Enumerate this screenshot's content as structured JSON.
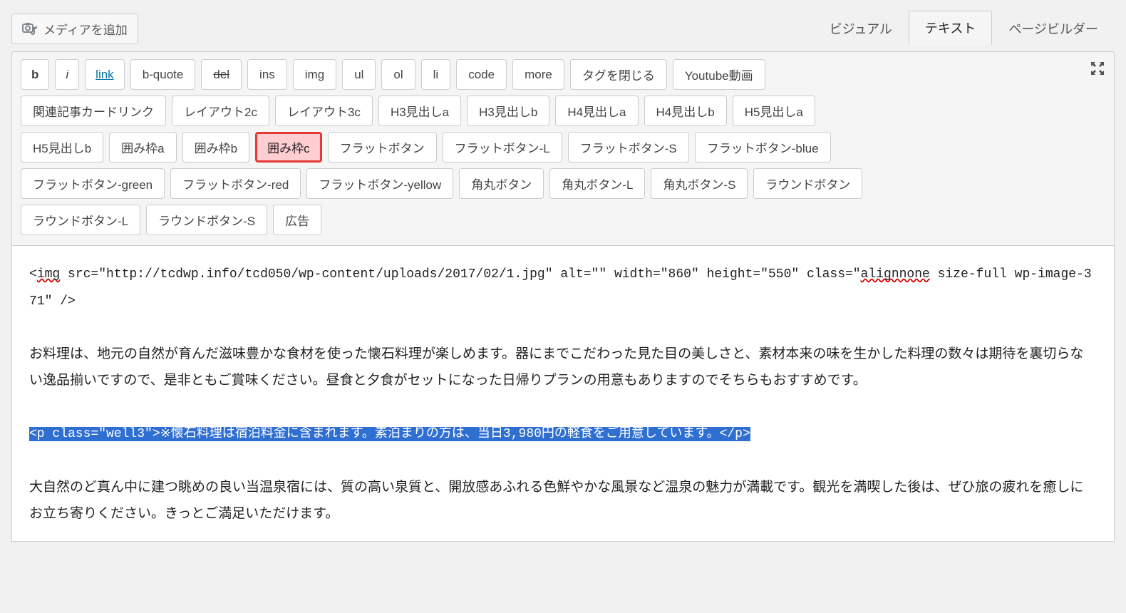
{
  "media_button_label": "メディアを追加",
  "tabs": {
    "visual": "ビジュアル",
    "text": "テキスト",
    "pagebuilder": "ページビルダー"
  },
  "quicktags": {
    "row1": [
      "b",
      "i",
      "link",
      "b-quote",
      "del",
      "ins",
      "img",
      "ul",
      "ol",
      "li",
      "code",
      "more",
      "タグを閉じる",
      "Youtube動画"
    ],
    "row2": [
      "関連記事カードリンク",
      "レイアウト2c",
      "レイアウト3c",
      "H3見出しa",
      "H3見出しb",
      "H4見出しa",
      "H4見出しb",
      "H5見出しa"
    ],
    "row3": [
      "H5見出しb",
      "囲み枠a",
      "囲み枠b",
      "囲み枠c",
      "フラットボタン",
      "フラットボタン-L",
      "フラットボタン-S",
      "フラットボタン-blue"
    ],
    "row4": [
      "フラットボタン-green",
      "フラットボタン-red",
      "フラットボタン-yellow",
      "角丸ボタン",
      "角丸ボタン-L",
      "角丸ボタン-S",
      "ラウンドボタン"
    ],
    "row5": [
      "ラウンドボタン-L",
      "ラウンドボタン-S",
      "広告"
    ]
  },
  "highlighted_quicktag": "囲み枠c",
  "editor_content": {
    "code_line1_a": "<",
    "code_line1_img": "img",
    "code_line1_b": " src=\"http://tcdwp.info/tcd050/wp-content/uploads/2017/02/1.jpg\" alt=\"\" width=\"860\" height=\"550\" class=\"",
    "code_line1_align": "alignnone",
    "code_line1_c": " size-full wp-image-371\" />",
    "para1": "お料理は、地元の自然が育んだ滋味豊かな食材を使った懐石料理が楽しめます。器にまでこだわった見た目の美しさと、素材本来の味を生かした料理の数々は期待を裏切らない逸品揃いですので、是非ともご賞味ください。昼食と夕食がセットになった日帰りプランの用意もありますのでそちらもおすすめです。",
    "selected_line": "<p class=\"well3\">※懐石料理は宿泊料金に含まれます。素泊まりの方は、当日3,980円の軽食をご用意しています。</p>",
    "para2": "大自然のど真ん中に建つ眺めの良い当温泉宿には、質の高い泉質と、開放感あふれる色鮮やかな風景など温泉の魅力が満載です。観光を満喫した後は、ぜひ旅の疲れを癒しにお立ち寄りください。きっとご満足いただけます。"
  }
}
